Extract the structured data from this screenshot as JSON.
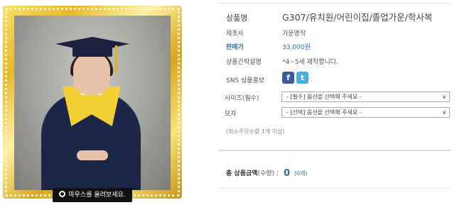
{
  "photo": {
    "zoom_caption": "마우스를 올려보세요."
  },
  "product": {
    "name_label": "상품명",
    "name_value": "G307/유치원/어린이집/졸업가운/학사복",
    "maker_label": "제조사",
    "maker_value": "가운명작",
    "price_label": "판매가",
    "price_value": "33,000원",
    "desc_label": "상품간략설명",
    "desc_value": "*4~5세 제작합니다.",
    "sns_label": "SNS 상품홍보",
    "sns_icons": [
      "facebook-icon",
      "twitter-icon"
    ]
  },
  "options": {
    "size_label": "사이즈(필수)",
    "size_selected": "- [필수] 옵션을 선택해 주세요 -",
    "cap_label": "모자",
    "cap_selected": "- [선택] 옵션을 선택해 주세요 -"
  },
  "min_qty": "(최소주문수량 1개 이상)",
  "total": {
    "label": "총 상품금액",
    "sub": "(수량)",
    "colon": ":",
    "amount": "0",
    "count": "(0개)"
  },
  "colors": {
    "accent": "#2a6fb7",
    "facebook": "#3b5a9a",
    "twitter": "#45aee6"
  }
}
